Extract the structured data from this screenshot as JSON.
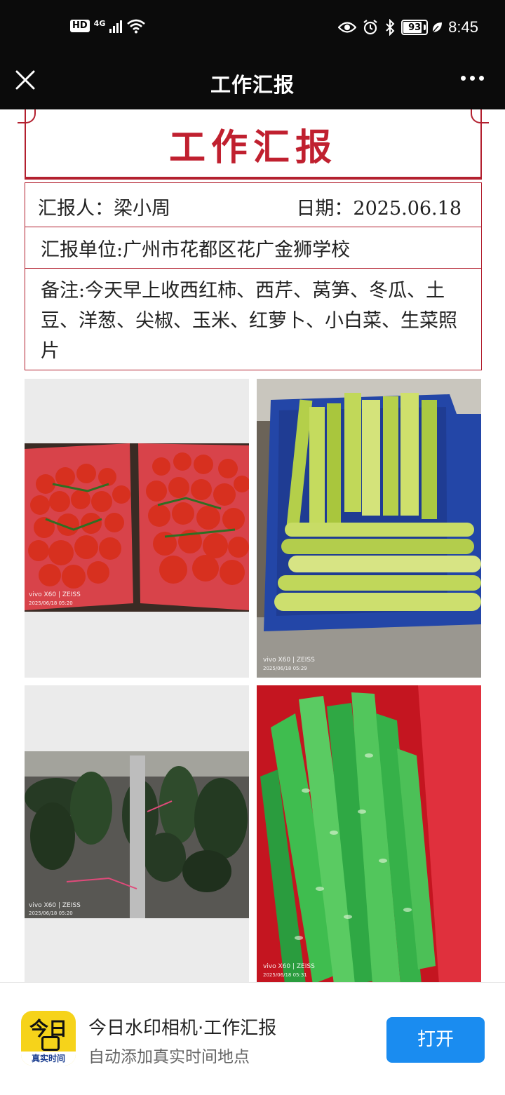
{
  "status_bar": {
    "hd": "HD",
    "network": "4G",
    "battery": "93",
    "battery_level": 0.93,
    "time": "8:45",
    "icons": [
      "signal-icon",
      "wifi-icon",
      "eye-icon",
      "alarm-icon",
      "bluetooth-icon",
      "battery-icon",
      "leaf-icon"
    ]
  },
  "header": {
    "title": "工作汇报",
    "close_icon": "close-icon",
    "more_icon": "more-icon"
  },
  "report": {
    "title": "工作汇报",
    "reporter": "汇报人：梁小周",
    "date": "日期：2025.06.18",
    "unit": "汇报单位:广州市花都区花广金狮学校",
    "note": "备注:今天早上收西红柿、西芹、莴笋、冬瓜、土豆、洋葱、尖椒、玉米、红萝卜、小白菜、生菜照片",
    "accent_color": "#b3202f"
  },
  "photos": [
    {
      "subject": "tomatoes",
      "camera": "vivo X60 | ZEISS",
      "stamp": "2025/06/18 05:20"
    },
    {
      "subject": "celery",
      "camera": "vivo X60 | ZEISS",
      "stamp": "2025/06/18 05:29"
    },
    {
      "subject": "winter-melon",
      "camera": "vivo X60 | ZEISS",
      "stamp": "2025/06/18 05:20"
    },
    {
      "subject": "lettuce-stems",
      "camera": "vivo X60 | ZEISS",
      "stamp": "2025/06/18 05:31"
    }
  ],
  "banner": {
    "icon_top": "今日",
    "icon_bottom": "真实时间",
    "app_name": "今日水印相机·工作汇报",
    "app_desc": "自动添加真实时间地点",
    "open_label": "打开",
    "button_color": "#1a8cf0"
  }
}
